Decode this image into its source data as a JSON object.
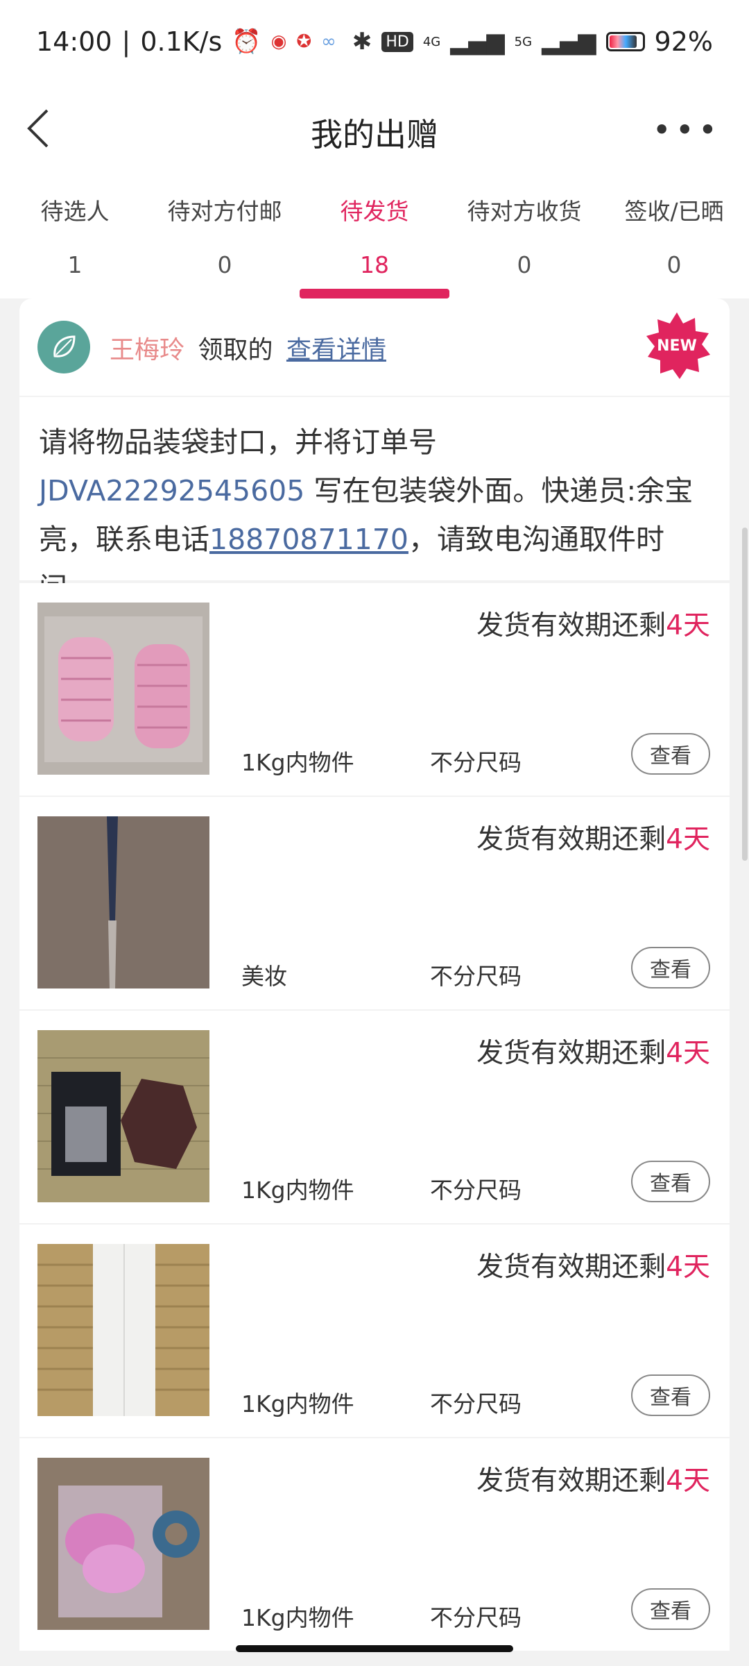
{
  "status_bar": {
    "time": "14:00",
    "speed": "0.1K/s",
    "battery": "92%",
    "network_4g": "4G",
    "network_5g": "5G",
    "hd": "HD"
  },
  "nav": {
    "title": "我的出赠"
  },
  "tabs": [
    {
      "label": "待选人",
      "count": "1"
    },
    {
      "label": "待对方付邮",
      "count": "0"
    },
    {
      "label": "待发货",
      "count": "18"
    },
    {
      "label": "待对方收货",
      "count": "0"
    },
    {
      "label": "签收/已晒",
      "count": "0"
    }
  ],
  "active_tab": 2,
  "header": {
    "name": "王梅玲",
    "claimed_text": "领取的",
    "detail_link": "查看详情",
    "badge": "NEW"
  },
  "notice": {
    "prefix": "请将物品装袋封口，并将订单号 ",
    "order_no": "JDVA22292545605",
    "middle": " 写在包装袋外面。快递员:余宝亮，联系电话",
    "phone": "18870871170",
    "suffix": "，请致电沟通取件时间。"
  },
  "items": [
    {
      "deadline_prefix": "发货有效期还剩",
      "days": "4天",
      "category": "1Kg内物件",
      "size": "不分尺码",
      "button": "查看",
      "thumb": "pink-hair-rollers"
    },
    {
      "deadline_prefix": "发货有效期还剩",
      "days": "4天",
      "category": "美妆",
      "size": "不分尺码",
      "button": "查看",
      "thumb": "makeup-brush"
    },
    {
      "deadline_prefix": "发货有效期还剩",
      "days": "4天",
      "category": "1Kg内物件",
      "size": "不分尺码",
      "button": "查看",
      "thumb": "eyelash-pack-and-box"
    },
    {
      "deadline_prefix": "发货有效期还剩",
      "days": "4天",
      "category": "1Kg内物件",
      "size": "不分尺码",
      "button": "查看",
      "thumb": "paper-strips"
    },
    {
      "deadline_prefix": "发货有效期还剩",
      "days": "4天",
      "category": "1Kg内物件",
      "size": "不分尺码",
      "button": "查看",
      "thumb": "pink-items-with-tape"
    }
  ],
  "colors": {
    "accent": "#e0245e",
    "link": "#4a6aa0",
    "name": "#e88a8a"
  }
}
